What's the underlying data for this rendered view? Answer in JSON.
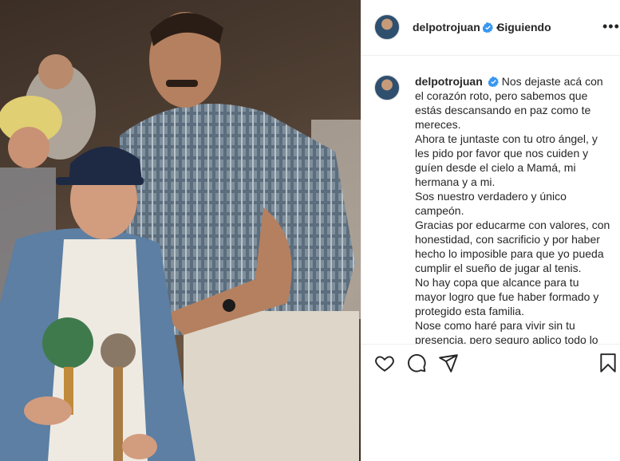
{
  "post": {
    "username": "delpotrojuan",
    "separator": "•",
    "follow_status": "Siguiendo",
    "more_label": "•••"
  },
  "caption": {
    "username": "delpotrojuan",
    "lines": [
      "Nos dejaste acá con el corazón roto, pero sabemos que estás descansando en paz como te mereces.",
      "Ahora te juntaste con tu otro ángel, y les pido por favor que nos cuiden y guíen desde el cielo a Mamá, mi hermana y a mi.",
      "Sos nuestro verdadero y único campeón.",
      "Gracias por educarme con valores, con honestidad, con sacrificio y por haber hecho lo imposible para que yo pueda cumplir el sueño de jugar al tenis.",
      "No hay copa que alcance para tu mayor logro que fue haber formado y protegido esta familia.",
      "Nose como haré para vivir sin tu presencia, pero seguro aplico todo lo"
    ]
  },
  "icons": {
    "verified": "verified-badge-icon",
    "like": "heart-icon",
    "comment": "comment-icon",
    "share": "share-icon",
    "save": "bookmark-icon"
  },
  "colors": {
    "verified_blue": "#3897f0",
    "text": "#262626",
    "border": "#efefef"
  }
}
